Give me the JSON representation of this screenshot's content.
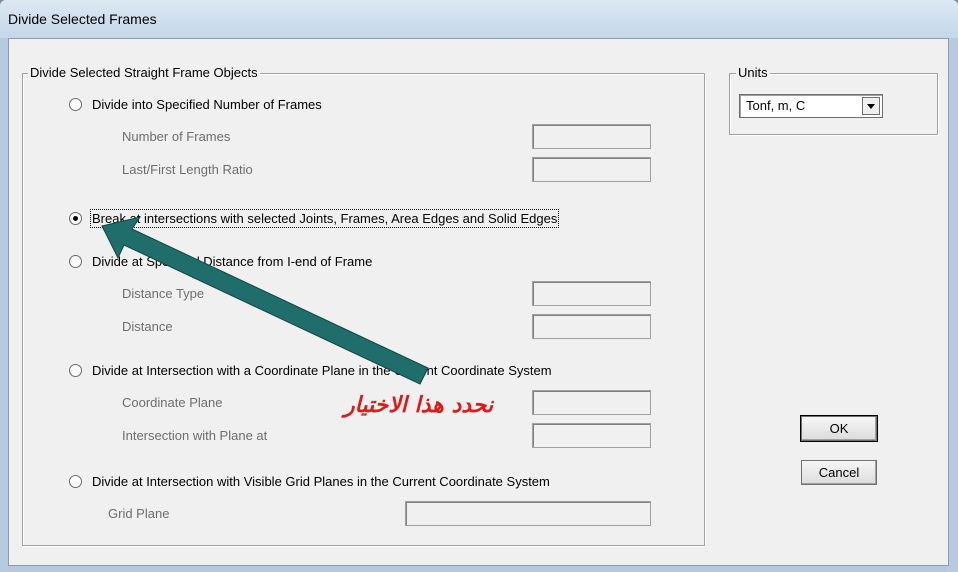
{
  "window": {
    "title": "Divide Selected Frames"
  },
  "group": {
    "title": "Divide Selected Straight Frame Objects"
  },
  "options": {
    "specified_number": {
      "label": "Divide into Specified Number of Frames"
    },
    "number_of_frames": {
      "label": "Number of Frames",
      "value": ""
    },
    "length_ratio": {
      "label": "Last/First Length Ratio",
      "value": ""
    },
    "break_intersections": {
      "label": "Break at intersections with selected Joints, Frames, Area Edges and Solid Edges",
      "checked": true
    },
    "specified_distance": {
      "label": "Divide at Specified Distance from I-end of Frame"
    },
    "distance_type": {
      "label": "Distance Type",
      "value": ""
    },
    "distance": {
      "label": "Distance",
      "value": ""
    },
    "coordinate_plane_option": {
      "label": "Divide at Intersection with a Coordinate Plane in the Current Coordinate System"
    },
    "coordinate_plane": {
      "label": "Coordinate Plane",
      "value": ""
    },
    "intersection_plane": {
      "label": "Intersection with Plane at",
      "value": ""
    },
    "grid_planes_option": {
      "label": "Divide at Intersection with Visible Grid Planes in the Current Coordinate System"
    },
    "grid_plane": {
      "label": "Grid Plane",
      "value": ""
    }
  },
  "units": {
    "title": "Units",
    "selected": "Tonf, m, C"
  },
  "buttons": {
    "ok": "OK",
    "cancel": "Cancel"
  },
  "annotation": {
    "text": "نحدد هذا الاختيار",
    "color": "#e01818"
  },
  "colors": {
    "arrow": "#1f6e6c",
    "dialog_bg": "#f0f0f0",
    "title_bar": "#c4d6e9"
  }
}
